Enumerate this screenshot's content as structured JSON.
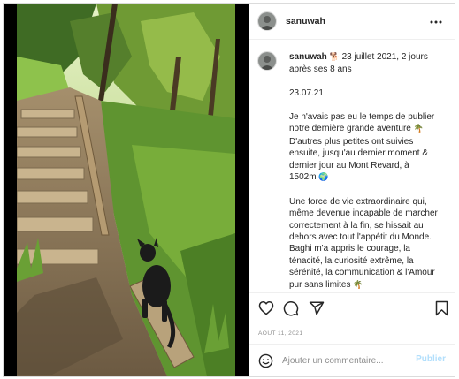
{
  "post": {
    "username": "sanuwah",
    "more_icon": "more-horizontal-icon",
    "caption": {
      "author": "sanuwah",
      "header_emoji": "🐕",
      "header_rest": " 23 juillet 2021, 2 jours après ses 8 ans",
      "date_line": "23.07.21",
      "para1_text": "Je n'avais pas eu le temps de publier notre dernière grande aventure ",
      "para1_emoji1": "🌴",
      "para1_text2": " D'autres plus petites ont suivies ensuite, jusqu'au dernier moment & dernier jour au Mont Revard, à 1502m ",
      "para1_emoji2": "🌍",
      "para2_text": "Une force de vie extraordinaire qui, même devenue incapable de marcher correctement à la fin, se hissait au dehors avec tout l'appétit du Monde. Baghi m'a appris le courage, la ténacité, la curiosité extrême, la sérénité, la communication & l'Amour pur sans limites ",
      "para2_emoji": "🌴"
    },
    "actions": [
      "heart-icon",
      "comment-icon",
      "share-icon",
      "bookmark-icon"
    ],
    "post_date": "AOÛT 11, 2021",
    "comment": {
      "emoji_icon": "smiley-icon",
      "placeholder": "Ajouter un commentaire...",
      "submit_label": "Publier"
    }
  },
  "colors": {
    "text": "#262626",
    "muted": "#8e8e8e",
    "border": "#dbdbdb",
    "publish_disabled": "#b2dffc"
  }
}
